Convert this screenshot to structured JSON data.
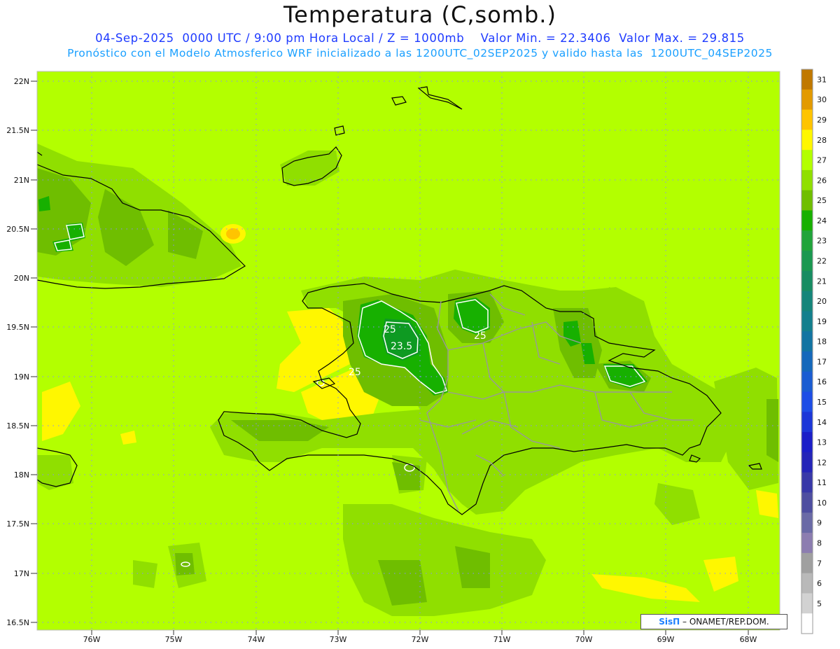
{
  "header": {
    "title": "Temperatura (C,somb.)",
    "line1": "04-Sep-2025  0000 UTC / 9:00 pm Hora Local / Z = 1000mb    Valor Min. = 22.3406  Valor Max. = 29.815",
    "line2": "Pronóstico con el Modelo Atmosferico WRF inicializado a las 1200UTC_02SEP2025 y valido hasta las  1200UTC_04SEP2025"
  },
  "map": {
    "lat_ticks": [
      "22N",
      "21.5N",
      "21N",
      "20.5N",
      "20N",
      "19.5N",
      "19N",
      "18.5N",
      "18N",
      "17.5N",
      "17N",
      "16.5N"
    ],
    "lon_ticks": [
      "76W",
      "75W",
      "74W",
      "73W",
      "72W",
      "71W",
      "70W",
      "69W",
      "68W"
    ],
    "contour_labels": [
      "25",
      "23.5",
      "25",
      "25"
    ],
    "background_color": "#b3ff00"
  },
  "colorbar": {
    "levels": [
      "31",
      "30",
      "29",
      "28",
      "27",
      "26",
      "25",
      "24",
      "23",
      "22",
      "21",
      "20",
      "19",
      "18",
      "17",
      "16",
      "15",
      "14",
      "13",
      "12",
      "11",
      "10",
      "9",
      "8",
      "7",
      "6",
      "5"
    ],
    "colors": [
      "#c07800",
      "#e39a00",
      "#ffc400",
      "#fff700",
      "#b3ff00",
      "#90df00",
      "#6fbe00",
      "#17b000",
      "#20a43a",
      "#1a9850",
      "#178c62",
      "#14857a",
      "#137f8d",
      "#1274a2",
      "#1568bb",
      "#1a5cd2",
      "#1d4de6",
      "#1c36d8",
      "#1b1ec8",
      "#2424b8",
      "#3838a8",
      "#4e4ea0",
      "#6a6aa6",
      "#8c7db0",
      "#a0a0a0",
      "#b9b9b9",
      "#d2d2d2",
      "#ffffff"
    ]
  },
  "credit": {
    "sis": "SisΠ",
    "rest": " – ONAMET/REP.DOM."
  }
}
